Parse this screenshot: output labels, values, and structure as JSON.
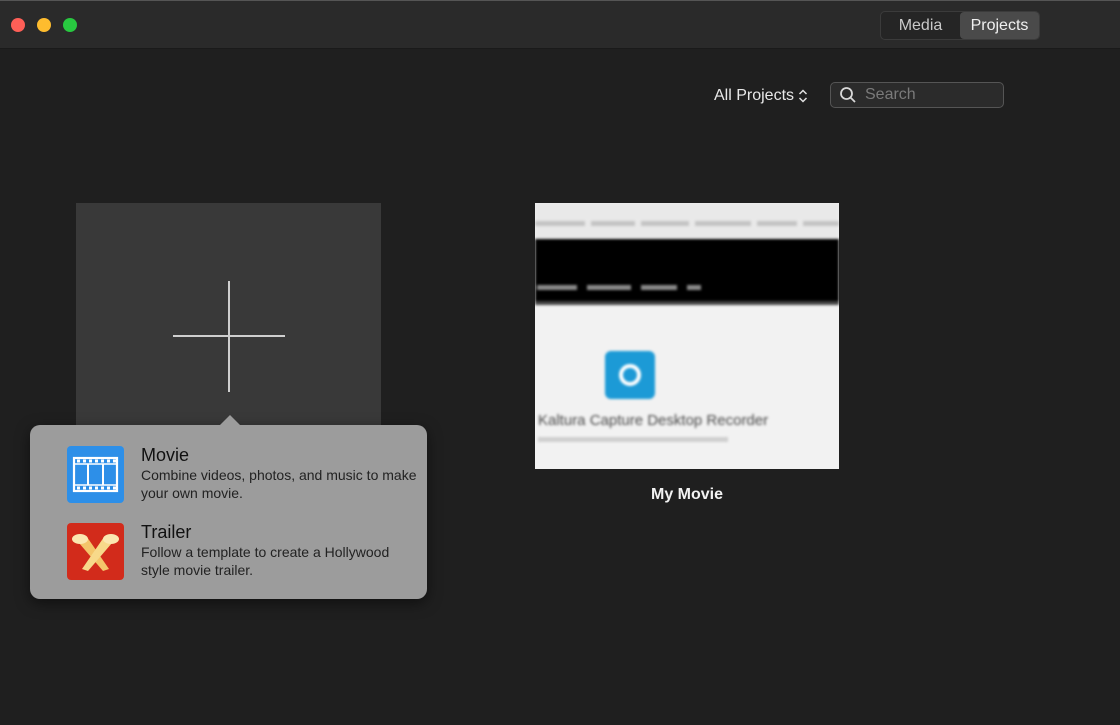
{
  "window": {
    "segments": [
      "Media",
      "Projects"
    ],
    "active_segment": "Projects"
  },
  "toolbar": {
    "filter_label": "All Projects",
    "search_placeholder": "Search"
  },
  "new_project": {
    "options": [
      {
        "title": "Movie",
        "description": "Combine videos, photos, and music to make your own movie.",
        "icon": "film-strip-icon"
      },
      {
        "title": "Trailer",
        "description": "Follow a template to create a Hollywood style movie trailer.",
        "icon": "spotlights-icon"
      }
    ]
  },
  "projects": [
    {
      "name": "My Movie",
      "thumbnail_text": "Kaltura Capture Desktop Recorder"
    }
  ],
  "colors": {
    "background": "#1f1f1f",
    "movie_icon": "#2d8fe8",
    "trailer_icon": "#d22b1b",
    "popover": "#9c9c9c"
  }
}
